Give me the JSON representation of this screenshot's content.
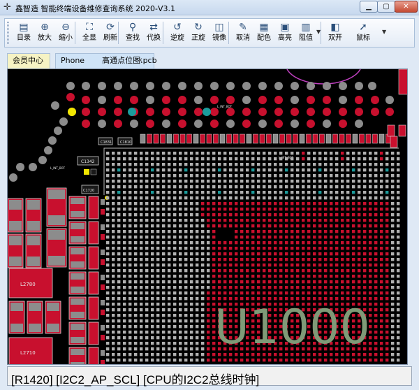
{
  "window": {
    "title": "鑫智造 智能终端设备维修查询系统 2020-V3.1",
    "min_label": "▁",
    "max_label": "▢",
    "close_label": "✕"
  },
  "toolbar": {
    "buttons": [
      {
        "label": "目录",
        "icon": "catalog-icon",
        "glyph": "▤"
      },
      {
        "label": "放大",
        "icon": "zoom-in-icon",
        "glyph": "⊕"
      },
      {
        "label": "缩小",
        "icon": "zoom-out-icon",
        "glyph": "⊖"
      },
      {
        "label": "全显",
        "icon": "fit-all-icon",
        "glyph": "⛶"
      },
      {
        "label": "刷新",
        "icon": "refresh-icon",
        "glyph": "⟳"
      },
      {
        "label": "查找",
        "icon": "search-icon",
        "glyph": "⚲"
      },
      {
        "label": "代换",
        "icon": "replace-icon",
        "glyph": "⇄"
      },
      {
        "label": "逆旋",
        "icon": "rotate-ccw-icon",
        "glyph": "↺"
      },
      {
        "label": "正旋",
        "icon": "rotate-cw-icon",
        "glyph": "↻"
      },
      {
        "label": "镜像",
        "icon": "mirror-icon",
        "glyph": "◫"
      },
      {
        "label": "取消",
        "icon": "cancel-highlight-icon",
        "glyph": "✎"
      },
      {
        "label": "配色",
        "icon": "palette-icon",
        "glyph": "▦"
      },
      {
        "label": "高亮",
        "icon": "highlight-icon",
        "glyph": "▣"
      },
      {
        "label": "阻值",
        "icon": "resistance-icon",
        "glyph": "▥"
      },
      {
        "label": "双开",
        "icon": "dual-open-icon",
        "glyph": "◧"
      },
      {
        "label": "鼠标",
        "icon": "mouse-pointer-icon",
        "glyph": "➚"
      }
    ]
  },
  "tabs": {
    "member": "会员中心",
    "pcb": "Phone",
    "pcb_file": "高通点位图.pcb",
    "close_glyph": "✕"
  },
  "board": {
    "chip_label": "U1000",
    "labels": {
      "l2780": "L2780",
      "l2710": "L2710",
      "lint_bot_1": "L_INT_BOT",
      "lint_bot_2": "L_INT_BOT",
      "lint_bot_3": "L_INT_BOT",
      "c1342": "C1342",
      "c1720": "C1720",
      "c1831": "C1831",
      "c1810": "C1810"
    },
    "colors": {
      "pad_red": "#c8102e",
      "pad_gray": "#8c8c8c",
      "pad_teal": "#1b9c9c",
      "pad_yellow": "#f2e600",
      "chip_text": "#7f9a77",
      "background": "#000000"
    }
  },
  "status": {
    "text": "[R1420]  [I2C2_AP_SCL]  [CPU的I2C2总线时钟]"
  }
}
